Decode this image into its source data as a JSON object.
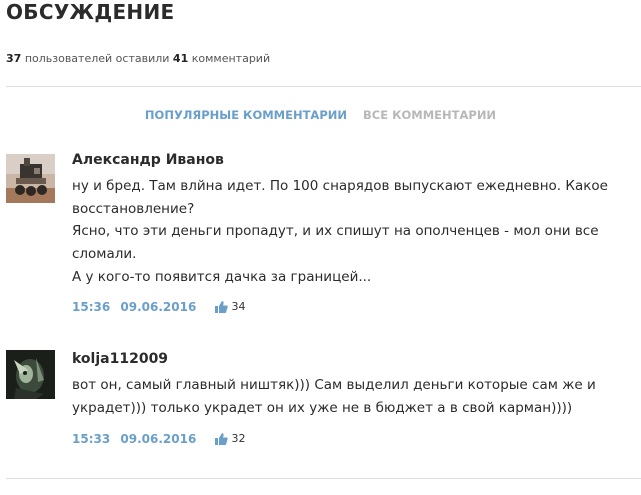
{
  "section": {
    "title": "ОБСУЖДЕНИЕ",
    "users_count": "37",
    "users_text": "пользователей оставили",
    "comments_count": "41",
    "comments_text": "комментарий"
  },
  "tabs": [
    {
      "label": "ПОПУЛЯРНЫЕ КОММЕНТАРИИ",
      "active": true
    },
    {
      "label": "ВСЕ КОММЕНТАРИИ",
      "active": false
    }
  ],
  "comments": [
    {
      "author": "Александр Иванов",
      "lines": [
        "ну и бред. Там влйна идет. По 100 снарядов выпускают ежедневно. Какое",
        "восстановление?",
        "Ясно, что эти деньги пропадут, и их спишут на ополченцев - мол они все",
        "сломали.",
        "А у кого-то появится дачка за границей..."
      ],
      "time": "15:36",
      "date": "09.06.2016",
      "likes": "34"
    },
    {
      "author": "kolja112009",
      "lines": [
        "вот он, самый главный ништяк))) Сам выделил деньги которые сам же и",
        "украдет))) только украдет он их уже не в бюджет а в свой карман))))"
      ],
      "time": "15:33",
      "date": "09.06.2016",
      "likes": "32"
    }
  ],
  "colors": {
    "accent": "#6a9fc9",
    "inactive_tab": "#b8b8b8",
    "text": "#2b2b2b",
    "divider": "#dedede"
  },
  "icons": [
    "avatar-rover-image",
    "avatar-dark-image",
    "thumbs-up-icon"
  ]
}
